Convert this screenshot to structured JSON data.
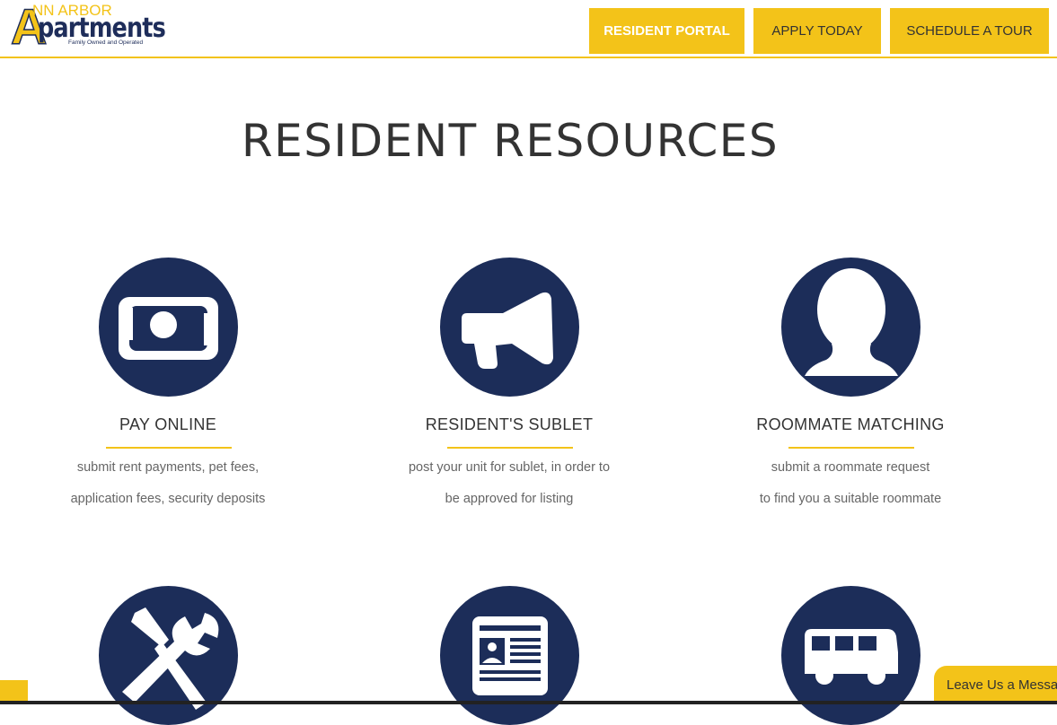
{
  "header": {
    "logo": {
      "big_letter": "A",
      "top_text": "NN ARBOR",
      "main_text": "partments",
      "tagline": "Family Owned and Operated"
    },
    "buttons": {
      "resident_portal": "RESIDENT PORTAL",
      "apply_today": "APPLY TODAY",
      "schedule_tour": "SCHEDULE A TOUR"
    }
  },
  "main": {
    "title": "RESIDENT RESOURCES",
    "cards": [
      {
        "icon": "money-icon",
        "title": "PAY ONLINE",
        "line1": "submit rent payments, pet fees,",
        "line2": "application fees, security deposits"
      },
      {
        "icon": "megaphone-icon",
        "title": "RESIDENT'S SUBLET",
        "line1": "post your unit for sublet, in order to",
        "line2": "be approved for listing"
      },
      {
        "icon": "user-silhouette-icon",
        "title": "ROOMMATE MATCHING",
        "line1": "submit a roommate request",
        "line2": "to find you a suitable roommate"
      },
      {
        "icon": "wrench-screwdriver-icon"
      },
      {
        "icon": "newspaper-icon"
      },
      {
        "icon": "bus-icon"
      }
    ]
  },
  "chat": {
    "label": "Leave Us a Message"
  },
  "colors": {
    "accent": "#f3c319",
    "navy": "#1c2d59"
  }
}
